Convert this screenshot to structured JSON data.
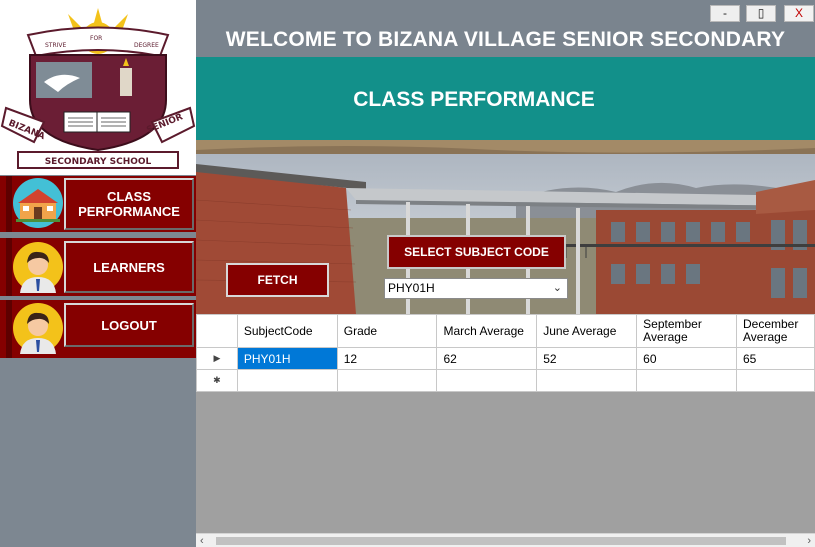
{
  "logo": {
    "top_ribbon_left": "STRIVE",
    "top_ribbon_mid": "FOR",
    "top_ribbon_right": "DEGREE",
    "ribbon_left": "BIZANA",
    "ribbon_right": "SENIOR",
    "bottom_text": "SECONDARY SCHOOL"
  },
  "sidebar": {
    "items": [
      {
        "label": "CLASS PERFORMANCE",
        "icon": "school-building-icon"
      },
      {
        "label": "LEARNERS",
        "icon": "student-avatar-icon"
      },
      {
        "label": "LOGOUT",
        "icon": "student-avatar-icon"
      }
    ]
  },
  "window": {
    "title": "WELCOME TO BIZANA VILLAGE SENIOR SECONDARY",
    "minimize": "-",
    "maximize": "▯",
    "close": "X"
  },
  "header": {
    "subtitle": "CLASS PERFORMANCE"
  },
  "controls": {
    "fetch_label": "FETCH",
    "select_label": "SELECT SUBJECT CODE",
    "subject_value": "PHY01H"
  },
  "table": {
    "columns": [
      "SubjectCode",
      "Grade",
      "March Average",
      "June Average",
      "September Average",
      "December Average"
    ],
    "rows": [
      [
        "PHY01H",
        "12",
        "62",
        "52",
        "60",
        "65"
      ]
    ]
  },
  "colors": {
    "accent_red": "#850000",
    "teal": "#12908a",
    "panel_gray": "#7a848e",
    "selection_blue": "#0078d7"
  }
}
